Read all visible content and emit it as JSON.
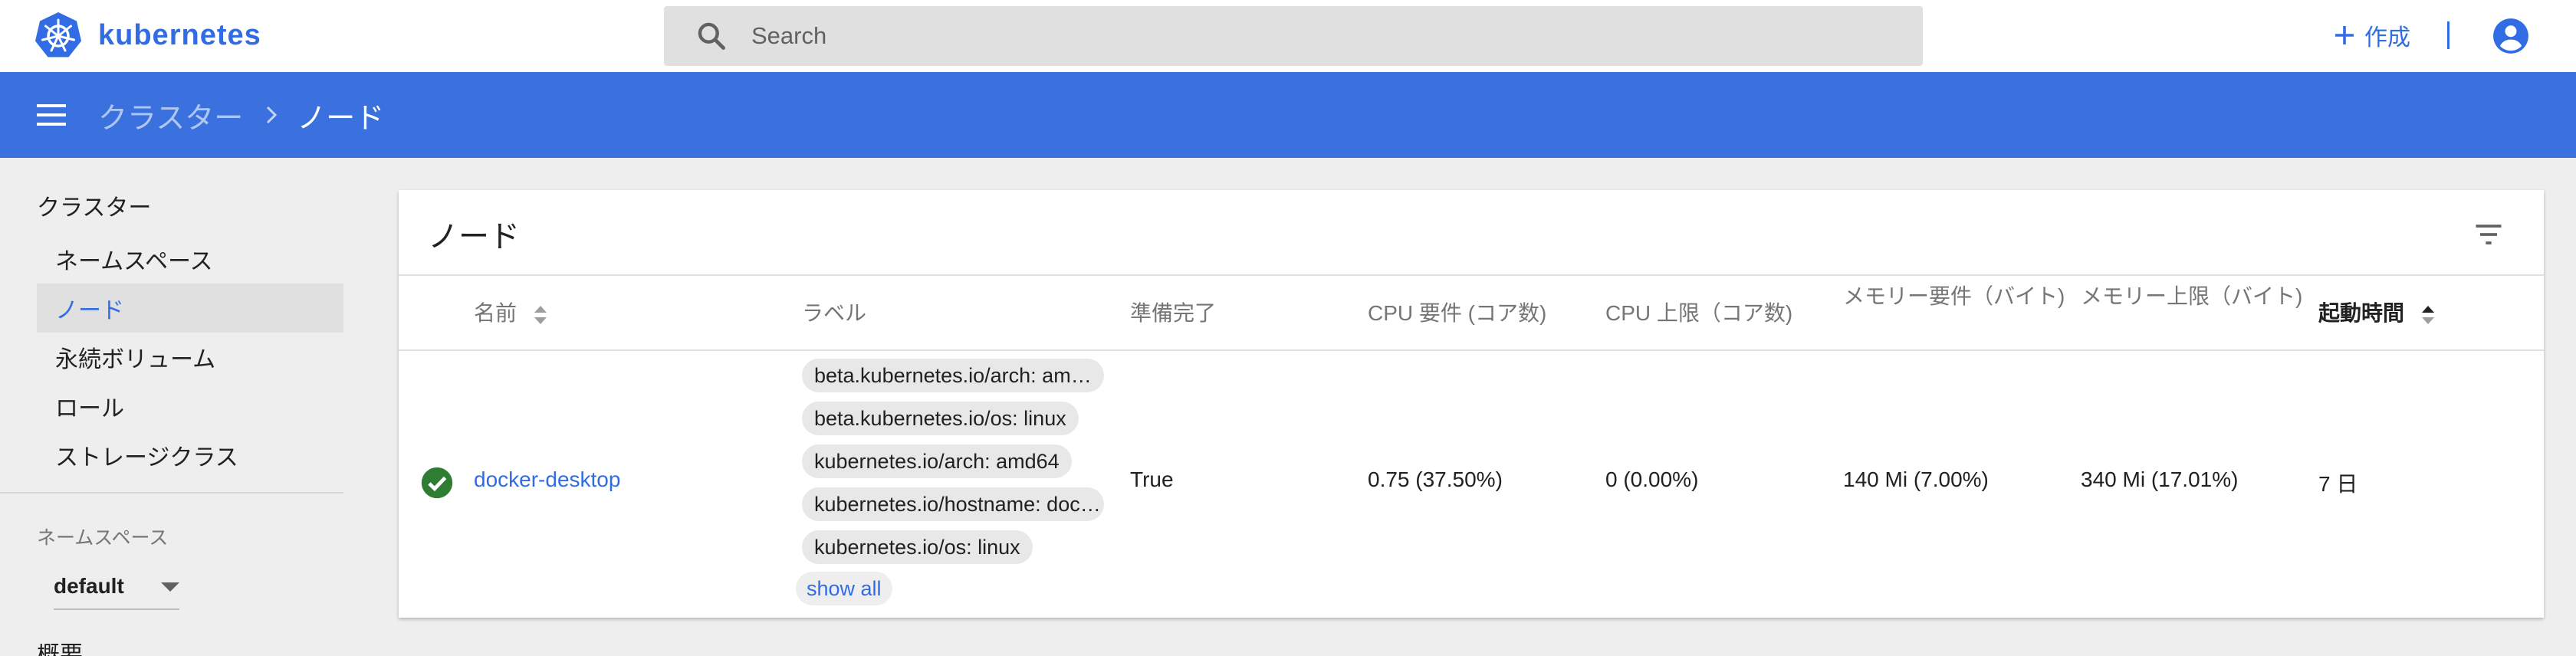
{
  "app": {
    "name": "kubernetes"
  },
  "search": {
    "placeholder": "Search"
  },
  "toolbar": {
    "create_label": "作成"
  },
  "breadcrumb": {
    "parent": "クラスター",
    "current": "ノード"
  },
  "sidebar": {
    "section_title": "クラスター",
    "items": [
      {
        "label": "ネームスペース"
      },
      {
        "label": "ノード",
        "active": true
      },
      {
        "label": "永続ボリューム"
      },
      {
        "label": "ロール"
      },
      {
        "label": "ストレージクラス"
      }
    ],
    "namespace_label": "ネームスペース",
    "namespace_value": "default",
    "cut_item": "概要"
  },
  "card": {
    "title": "ノード",
    "columns": {
      "name": "名前",
      "labels": "ラベル",
      "ready": "準備完了",
      "cpu_requests": "CPU 要件 (コア数)",
      "cpu_limits": "CPU 上限（コア数)",
      "memory_requests": "メモリー要件（バイト)",
      "memory_limits": "メモリー上限（バイト)",
      "age": "起動時間"
    },
    "rows": [
      {
        "status": "ok",
        "name": "docker-desktop",
        "labels": [
          "beta.kubernetes.io/arch: am…",
          "beta.kubernetes.io/os: linux",
          "kubernetes.io/arch: amd64",
          "kubernetes.io/hostname: doc…",
          "kubernetes.io/os: linux"
        ],
        "show_all": "show all",
        "ready": "True",
        "cpu_requests": "0.75 (37.50%)",
        "cpu_limits": "0 (0.00%)",
        "memory_requests": "140 Mi (7.00%)",
        "memory_limits": "340 Mi (17.01%)",
        "age": "7 日"
      }
    ]
  },
  "colors": {
    "accent": "#326ce5",
    "action_bar": "#3a71df",
    "status_ok": "#2e7d32"
  },
  "icons": [
    "kubernetes-logo-icon",
    "search-icon",
    "plus-icon",
    "account-circle-icon",
    "menu-icon",
    "chevron-right-icon",
    "filter-icon",
    "sort-icon",
    "check-circle-icon"
  ]
}
